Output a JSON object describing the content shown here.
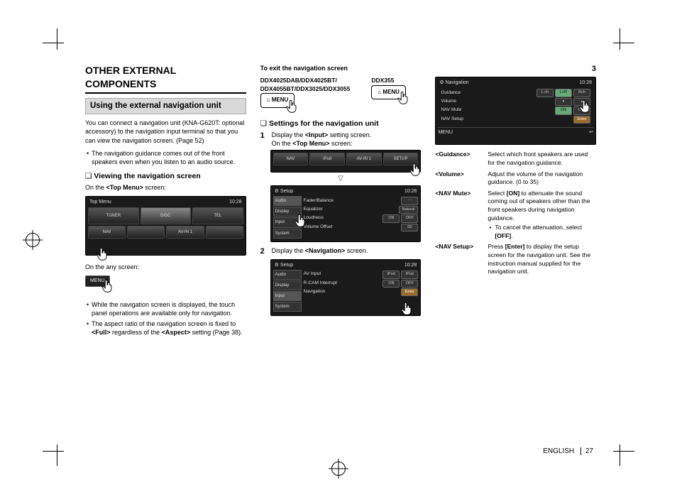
{
  "page": {
    "section_title": "OTHER EXTERNAL COMPONENTS",
    "footer_lang": "ENGLISH",
    "footer_num": "27"
  },
  "col1": {
    "subheading": "Using the external navigation unit",
    "intro": "You can connect a navigation unit (KNA-G620T: optional accessory) to the navigation input terminal so that you can view the navigation screen. (Page 52)",
    "bullet1": "The navigation guidance comes out of the front speakers even when you listen to an audio source.",
    "q1": "Viewing the navigation screen",
    "on_top": "On the <Top Menu> screen:",
    "on_any": "On the any screen:",
    "note1": "While the navigation screen is displayed, the touch panel operations are available only for navigation.",
    "note2_a": "The aspect ratio of the navigation screen is fixed to ",
    "note2_b": "<Full>",
    "note2_c": " regardless of the ",
    "note2_d": "<Aspect>",
    "note2_e": " setting (Page 38).",
    "top_menu": {
      "label": "Top Menu",
      "clock": "10:28",
      "row1": [
        "TUNER",
        "DISC",
        "TEL"
      ],
      "row2": [
        "NAV",
        "",
        "AV-IN 1",
        ""
      ]
    },
    "menu_btn": "MENU"
  },
  "col2": {
    "exit_title": "To exit the navigation screen",
    "models_a": "DDX4025DAB/DDX4025BT/\nDDX4055BT/DDX3025/DDX3055",
    "models_b": "DDX355",
    "exit_btn": "MENU",
    "q2": "Settings for the navigation unit",
    "step1_num": "1",
    "step1_a": "Display the ",
    "step1_b": "<Input>",
    "step1_c": " setting screen.",
    "step1_d": "On the <Top Menu> screen:",
    "scrA": {
      "row": [
        "NAV",
        "iPod",
        "AV-IN 1",
        "SETUP"
      ]
    },
    "scrB": {
      "title": "Setup",
      "clock": "10:28",
      "tabs": [
        "Audio",
        "Display",
        "Input",
        "System"
      ],
      "rows": [
        {
          "label": "Fader/Balance",
          "btn": ""
        },
        {
          "label": "Equalizer",
          "btn": "Natural"
        },
        {
          "label": "Loudness",
          "on": "ON",
          "off": "OFF"
        },
        {
          "label": "Volume Offset",
          "v": "00"
        }
      ]
    },
    "step2_num": "2",
    "step2_a": "Display the ",
    "step2_b": "<Navigation>",
    "step2_c": " screen.",
    "scrC": {
      "title": "Setup",
      "clock": "10:28",
      "tabs": [
        "Audio",
        "Display",
        "Input",
        "System"
      ],
      "rows": [
        {
          "label": "AV Input",
          "a": "iPod",
          "b": "iPod"
        },
        {
          "label": "R-CAM Interrupt",
          "on": "ON",
          "off": "OFF"
        },
        {
          "label": "Navigation",
          "btn": "Enter"
        }
      ]
    }
  },
  "col3": {
    "step3_num": "3",
    "scr": {
      "title": "Navigation",
      "clock": "10:28",
      "rows": [
        {
          "label": "Guidance",
          "a": "L ch",
          "b": "L+R",
          "c": "Rch"
        },
        {
          "label": "Volume",
          "v": ""
        },
        {
          "label": "NAV Mute",
          "on": "ON",
          "off": "OFF"
        },
        {
          "label": "NAV Setup",
          "btn": "Enter"
        }
      ],
      "footer_menu": "MENU"
    },
    "defs": {
      "guidance": {
        "t": "<Guidance>",
        "d": "Select which front speakers are used for the navigation guidance."
      },
      "volume": {
        "t": "<Volume>",
        "d": "Adjust the volume of the navigation guidance. (0 to 35)"
      },
      "navmute": {
        "t": "<NAV Mute>",
        "d_a": "Select ",
        "d_b": "[ON]",
        "d_c": " to attenuate the sound coming out of speakers other than the front speakers during navigation guidance.",
        "sub_a": "To cancel the attenuation, select ",
        "sub_b": "[OFF]",
        "sub_c": "."
      },
      "navsetup": {
        "t": "<NAV Setup>",
        "d_a": "Press ",
        "d_b": "[Enter]",
        "d_c": " to display the setup screen for the navigation unit. See the instruction manual supplied for the navigation unit."
      }
    }
  }
}
